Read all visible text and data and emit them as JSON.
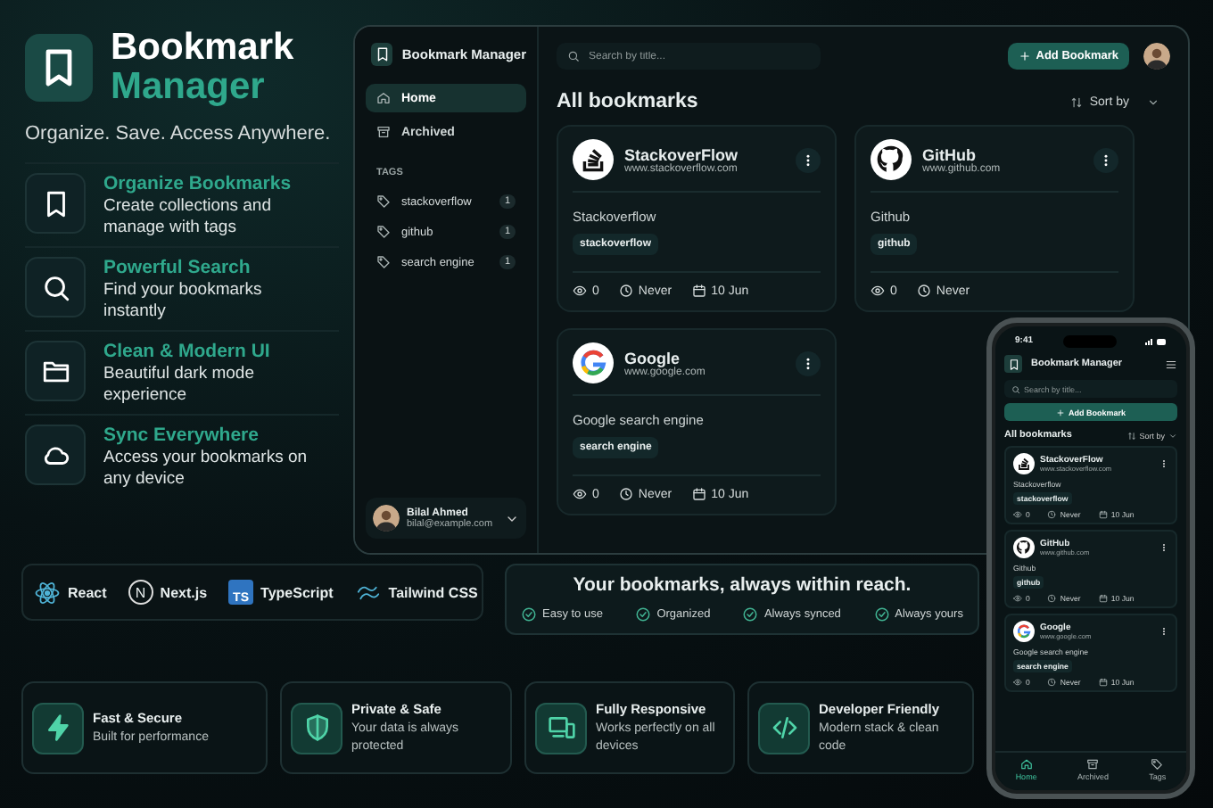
{
  "brand": {
    "title_line1": "Bookmark",
    "title_line2": "Manager",
    "tagline": "Organize. Save. Access Anywhere."
  },
  "features": [
    {
      "kind": "bookmark",
      "title": "Organize Bookmarks",
      "text": "Create collections and manage with tags"
    },
    {
      "kind": "search",
      "title": "Powerful Search",
      "text": "Find your bookmarks instantly"
    },
    {
      "kind": "folder",
      "title": "Clean & Modern UI",
      "text": "Beautiful dark mode experience"
    },
    {
      "kind": "cloud",
      "title": "Sync Everywhere",
      "text": "Access your bookmarks on any device"
    }
  ],
  "app": {
    "title": "Bookmark Manager",
    "search": {
      "placeholder": "Search by title..."
    },
    "add_button": "Add Bookmark",
    "nav": [
      {
        "kind": "home",
        "label": "Home",
        "selected": true
      },
      {
        "kind": "archive",
        "label": "Archived",
        "selected": false
      }
    ],
    "tags_heading": "TAGS",
    "tags": [
      {
        "name": "stackoverflow",
        "count": "1"
      },
      {
        "name": "github",
        "count": "1"
      },
      {
        "name": "search engine",
        "count": "1"
      }
    ],
    "user": {
      "name": "Bilal Ahmed",
      "email": "bilal@example.com"
    },
    "heading": "All bookmarks",
    "sort": "Sort by",
    "bookmarks": [
      {
        "kind": "stackoverflow",
        "title": "StackoverFlow",
        "url": "www.stackoverflow.com",
        "description": "Stackoverflow",
        "tag": "stackoverflow",
        "views": "0",
        "last_visited": "Never",
        "date": "10 Jun"
      },
      {
        "kind": "github",
        "title": "GitHub",
        "url": "www.github.com",
        "description": "Github",
        "tag": "github",
        "views": "0",
        "last_visited": "Never"
      },
      {
        "kind": "google",
        "title": "Google",
        "url": "www.google.com",
        "description": "Google search engine",
        "tag": "search engine",
        "views": "0",
        "last_visited": "Never",
        "date": "10 Jun"
      }
    ]
  },
  "phone": {
    "time": "9:41",
    "title": "Bookmark Manager",
    "search": {
      "placeholder": "Search by title..."
    },
    "add_button": "Add Bookmark",
    "heading": "All bookmarks",
    "sort": "Sort by",
    "bookmarks": [
      {
        "kind": "stackoverflow",
        "title": "StackoverFlow",
        "url": "www.stackoverflow.com",
        "description": "Stackoverflow",
        "tag": "stackoverflow",
        "views": "0",
        "last_visited": "Never",
        "date": "10 Jun"
      },
      {
        "kind": "github",
        "title": "GitHub",
        "url": "www.github.com",
        "description": "Github",
        "tag": "github",
        "views": "0",
        "last_visited": "Never",
        "date": "10 Jun"
      },
      {
        "kind": "google",
        "title": "Google",
        "url": "www.google.com",
        "description": "Google search engine",
        "tag": "search engine",
        "views": "0",
        "last_visited": "Never",
        "date": "10 Jun"
      }
    ],
    "nav": [
      {
        "kind": "home",
        "label": "Home",
        "selected": true
      },
      {
        "kind": "archive",
        "label": "Archived",
        "selected": false
      },
      {
        "kind": "tag",
        "label": "Tags",
        "selected": false
      }
    ]
  },
  "tech_stack": [
    {
      "kind": "react",
      "label": "React"
    },
    {
      "kind": "next",
      "badge": "N",
      "label": "Next.js"
    },
    {
      "kind": "typescript",
      "badge": "TS",
      "label": "TypeScript"
    },
    {
      "kind": "tailwind",
      "label": "Tailwind CSS"
    }
  ],
  "promo": {
    "title": "Your bookmarks, always within reach.",
    "points": [
      "Easy to use",
      "Organized",
      "Always synced",
      "Always yours"
    ]
  },
  "highlights": [
    {
      "kind": "bolt",
      "title": "Fast & Secure",
      "text": "Built for performance"
    },
    {
      "kind": "shield",
      "title": "Private & Safe",
      "text": "Your data is always protected"
    },
    {
      "kind": "devices",
      "title": "Fully Responsive",
      "text": "Works perfectly on all devices"
    },
    {
      "kind": "code",
      "title": "Developer Friendly",
      "text": "Modern stack & clean code"
    }
  ]
}
